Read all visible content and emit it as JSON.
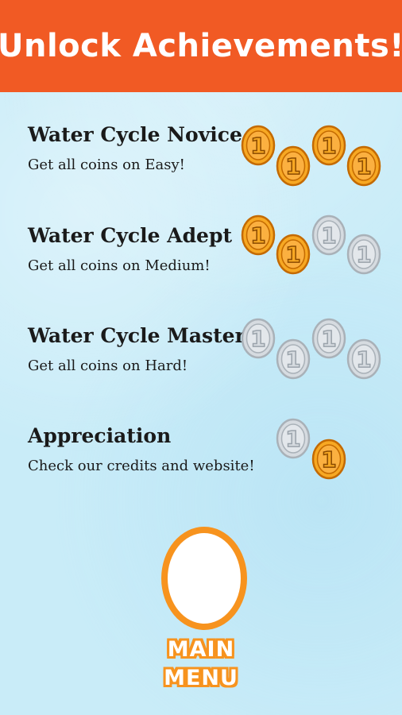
{
  "header": {
    "title": "Unlock Achievements!"
  },
  "achievements": [
    {
      "title": "Water Cycle Novice",
      "description": "Get all coins on Easy!",
      "coins": [
        "gold",
        "gold",
        "gold",
        "gold"
      ],
      "coin_label": "1"
    },
    {
      "title": "Water Cycle Adept",
      "description": "Get all coins on Medium!",
      "coins": [
        "gold",
        "gold",
        "silver",
        "silver"
      ],
      "coin_label": "1"
    },
    {
      "title": "Water Cycle Master",
      "description": "Get all coins on Hard!",
      "coins": [
        "silver",
        "silver",
        "silver",
        "silver"
      ],
      "coin_label": "1"
    },
    {
      "title": "Appreciation",
      "description": "Check our credits and website!",
      "coins": [
        "silver",
        "gold"
      ],
      "coin_label": "1"
    }
  ],
  "main_menu": {
    "line1": "MAIN",
    "line2": "MENU"
  },
  "colors": {
    "header_bg": "#f15a24",
    "accent_orange": "#f7931e",
    "gold": "#f7a823",
    "silver": "#d6dbe0",
    "background": "#c9ecf8"
  }
}
